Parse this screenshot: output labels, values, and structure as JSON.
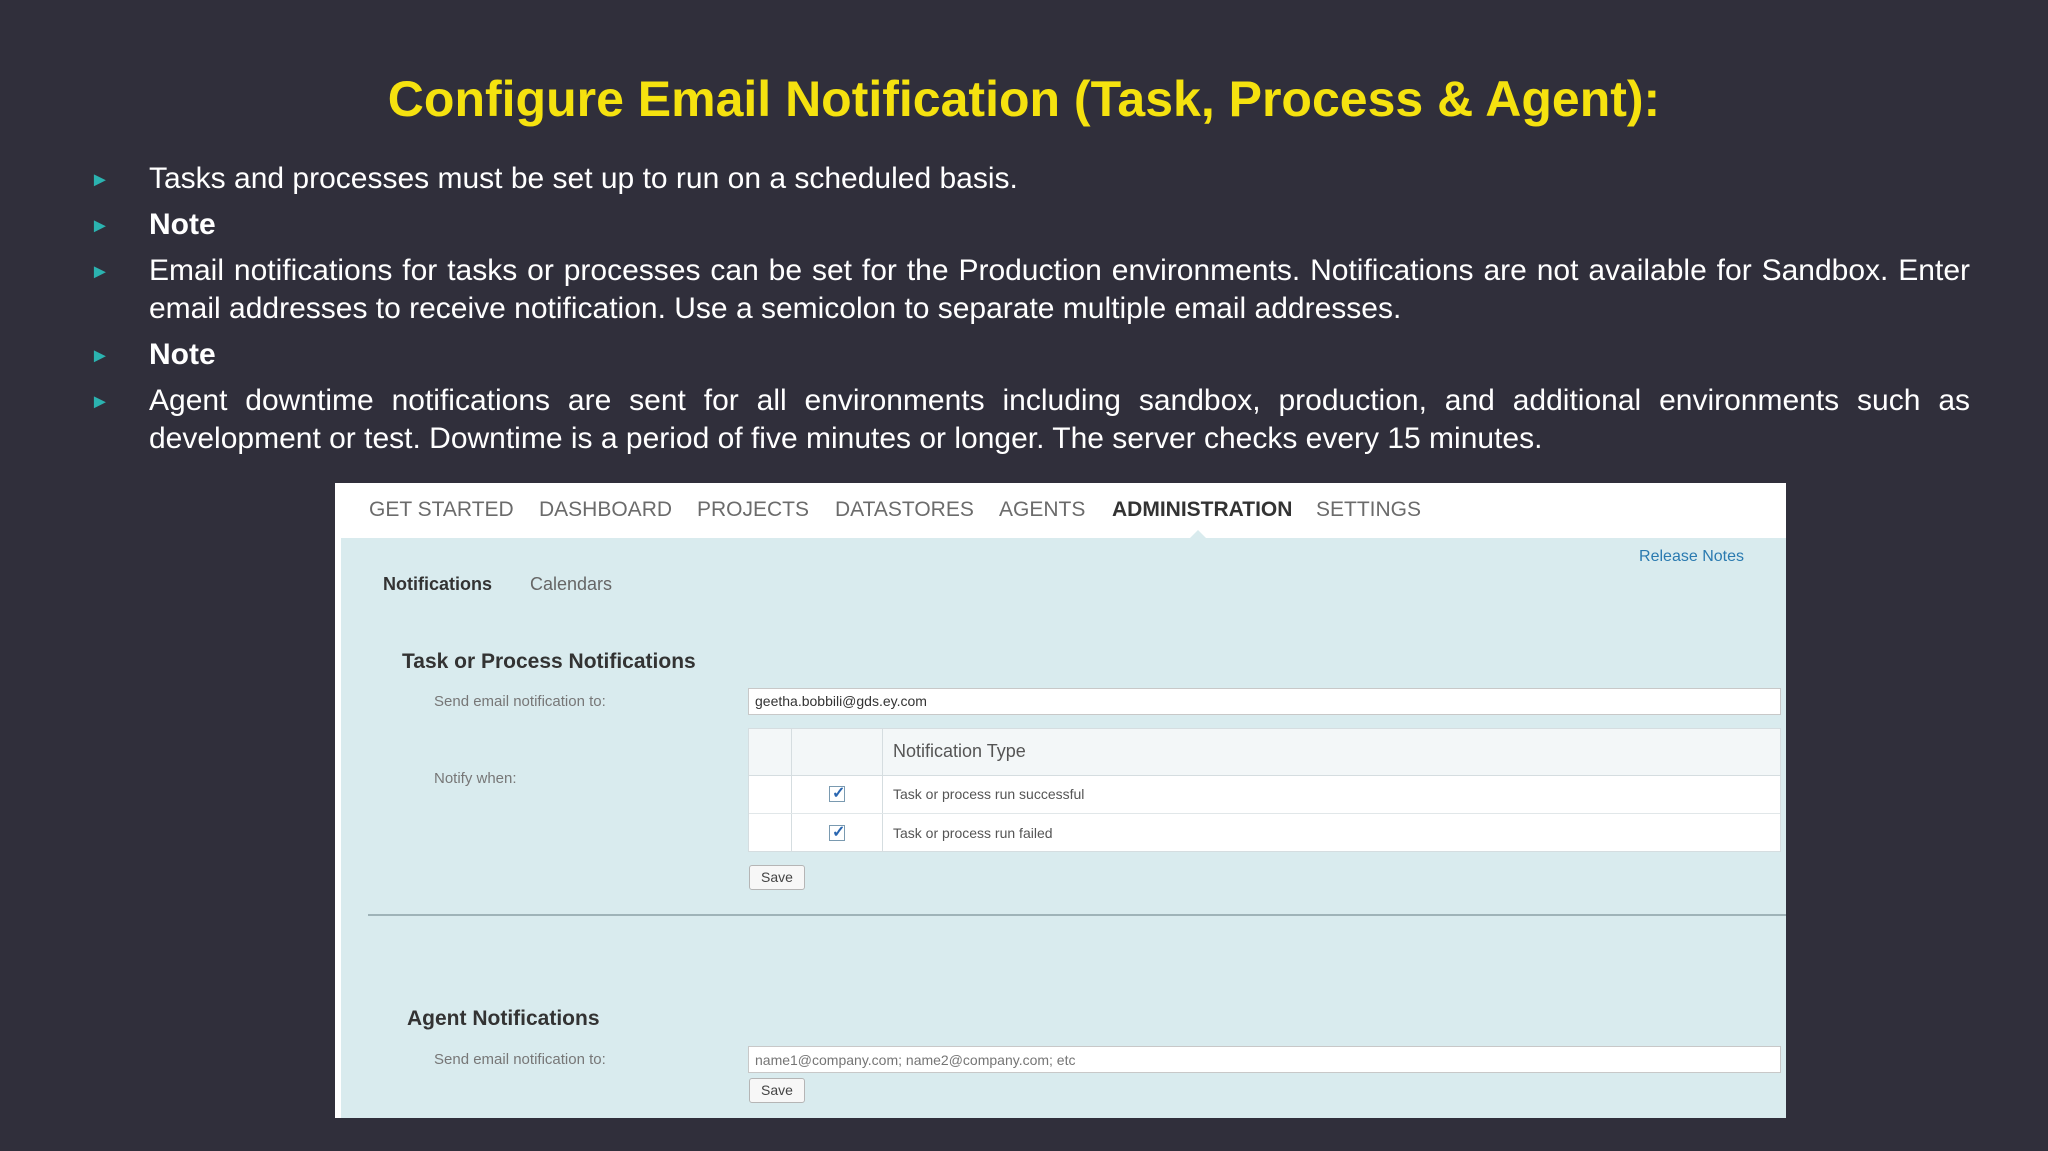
{
  "slide": {
    "title": "Configure Email Notification (Task, Process & Agent):",
    "bullet_marker": "►",
    "bullets": [
      "Tasks and processes must be set up to run on a scheduled basis.",
      "Note",
      "Email notifications for tasks or processes can be set for the Production environments. Notifications are not available for Sandbox. Enter email addresses to receive notification. Use a semicolon to separate multiple email addresses.",
      "Note",
      "Agent downtime notifications are sent for all environments including sandbox, production, and additional environments such as development or test. Downtime is a period of five minutes or longer. The server checks every 15 minutes."
    ]
  },
  "colors": {
    "background": "#302f3b",
    "title": "#f5e20f",
    "bullet_marker": "#2bb3b0",
    "panel_background": "#d9ebee",
    "link": "#2a7ab0"
  },
  "app": {
    "nav": [
      "GET STARTED",
      "DASHBOARD",
      "PROJECTS",
      "DATASTORES",
      "AGENTS",
      "ADMINISTRATION",
      "SETTINGS"
    ],
    "active_nav": "ADMINISTRATION",
    "release_notes": "Release Notes",
    "subtabs": [
      "Notifications",
      "Calendars"
    ],
    "active_subtab": "Notifications",
    "task_section": {
      "title": "Task or Process Notifications",
      "send_label": "Send email notification to:",
      "email_value": "geetha.bobbili@gds.ey.com",
      "notify_label": "Notify when:",
      "table_header": "Notification Type",
      "rows": [
        {
          "label": "Task or process run successful",
          "checked": true
        },
        {
          "label": "Task or process run failed",
          "checked": true
        }
      ],
      "save_label": "Save"
    },
    "agent_section": {
      "title": "Agent Notifications",
      "send_label": "Send email notification to:",
      "email_placeholder": "name1@company.com; name2@company.com; etc",
      "save_label": "Save"
    }
  }
}
